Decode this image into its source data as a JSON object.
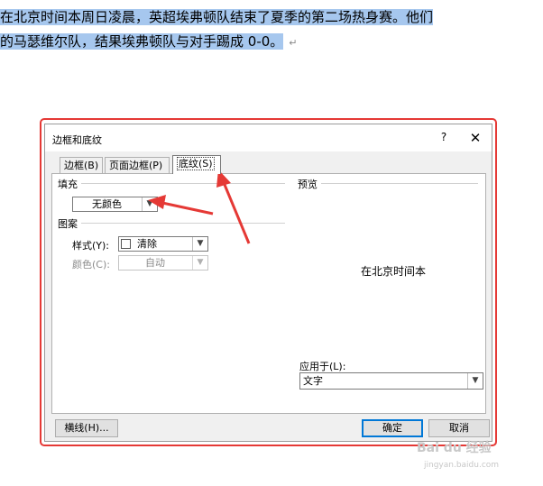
{
  "document": {
    "line1": "在北京时间本周日凌晨，英超埃弗顿队结束了夏季的第二场热身赛。他们",
    "line2": "的马瑟维尔队，结果埃弗顿队与对手踢成 0-0。",
    "paragraph_mark": "↵"
  },
  "dialog": {
    "title": "边框和底纹",
    "help_label": "?",
    "close_label": "✕",
    "tabs": [
      {
        "label": "边框(B)"
      },
      {
        "label": "页面边框(P)"
      },
      {
        "label": "底纹(S)",
        "selected": true
      }
    ],
    "fill": {
      "group_label": "填充",
      "value": "无颜色"
    },
    "pattern": {
      "group_label": "图案",
      "style_label": "样式(Y):",
      "style_value": "清除",
      "color_label": "颜色(C):",
      "color_value": "自动"
    },
    "preview": {
      "group_label": "预览",
      "sample_text": "在北京时间本",
      "apply_to_label": "应用于(L):",
      "apply_to_value": "文字"
    },
    "buttons": {
      "horizontal_line": "横线(H)...",
      "ok": "确定",
      "cancel": "取消"
    }
  },
  "annotations": {
    "arrow_color": "#e53935",
    "highlight_color": "#a6c7ee"
  },
  "watermark": {
    "text": "Bai du 经验",
    "url": "jingyan.baidu.com"
  },
  "icons": [
    "chevron-down-icon",
    "close-icon",
    "help-icon",
    "annotation-arrow"
  ]
}
